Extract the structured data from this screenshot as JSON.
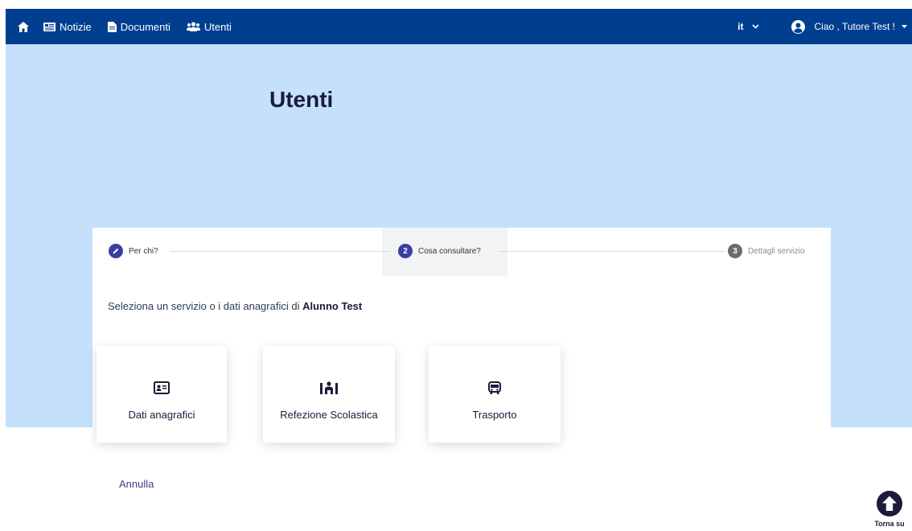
{
  "navbar": {
    "items": [
      {
        "label": "Notizie"
      },
      {
        "label": "Documenti"
      },
      {
        "label": "Utenti"
      }
    ],
    "language": "it",
    "user_greeting": "Ciao , Tutore Test !"
  },
  "page": {
    "title": "Utenti"
  },
  "stepper": {
    "steps": [
      {
        "number": "1",
        "label": "Per chi?",
        "state": "completed"
      },
      {
        "number": "2",
        "label": "Cosa consultare?",
        "state": "active"
      },
      {
        "number": "3",
        "label": "Dettagli servizio",
        "state": "pending"
      }
    ]
  },
  "prompt": {
    "text": "Seleziona un servizio o i dati anagrafici di ",
    "student": "Alunno Test"
  },
  "services": [
    {
      "label": "Dati anagrafici",
      "icon": "id-card-icon"
    },
    {
      "label": "Refezione Scolastica",
      "icon": "canteen-icon"
    },
    {
      "label": "Trasporto",
      "icon": "bus-icon"
    }
  ],
  "actions": {
    "cancel": "Annulla",
    "back_to_top": "Torna su"
  },
  "colors": {
    "navbar": "#003e8f",
    "hero": "#c4e0fb",
    "step_active": "#3a3f9e",
    "step_pending": "#6b6b6b"
  }
}
